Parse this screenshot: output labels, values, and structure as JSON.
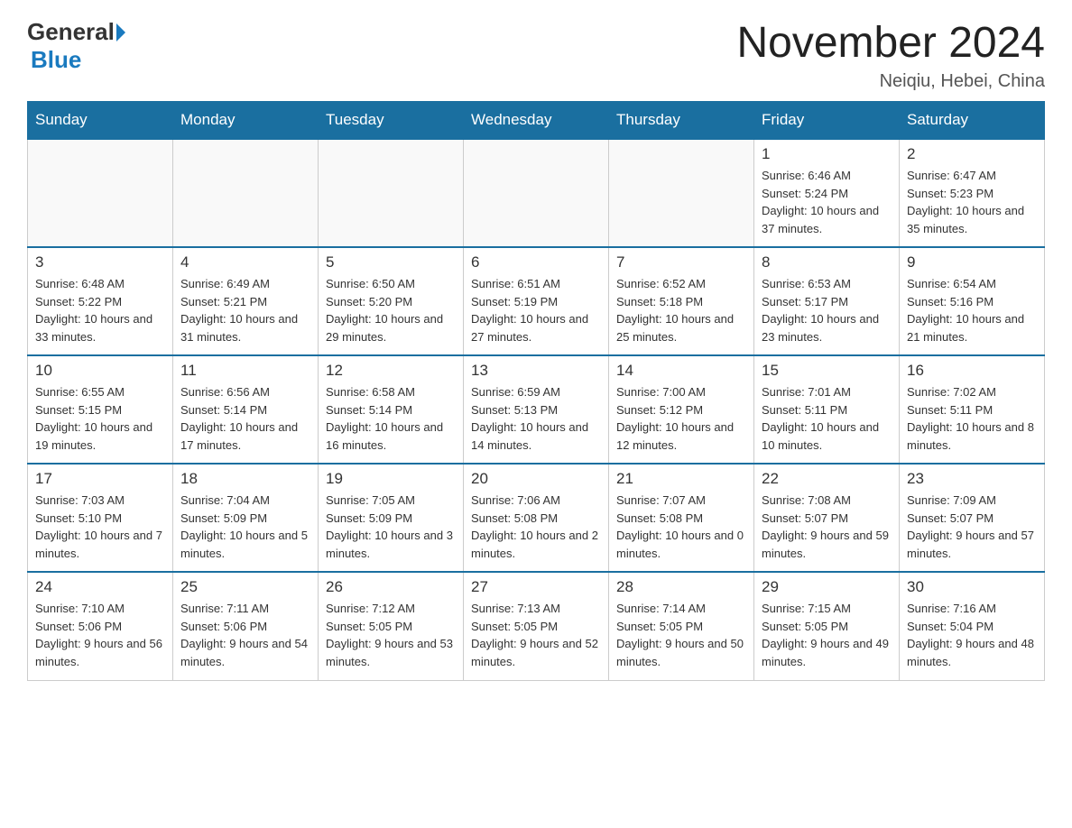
{
  "header": {
    "logo_general": "General",
    "logo_blue": "Blue",
    "title": "November 2024",
    "subtitle": "Neiqiu, Hebei, China"
  },
  "days_of_week": [
    "Sunday",
    "Monday",
    "Tuesday",
    "Wednesday",
    "Thursday",
    "Friday",
    "Saturday"
  ],
  "weeks": [
    [
      {
        "day": "",
        "info": ""
      },
      {
        "day": "",
        "info": ""
      },
      {
        "day": "",
        "info": ""
      },
      {
        "day": "",
        "info": ""
      },
      {
        "day": "",
        "info": ""
      },
      {
        "day": "1",
        "info": "Sunrise: 6:46 AM\nSunset: 5:24 PM\nDaylight: 10 hours and 37 minutes."
      },
      {
        "day": "2",
        "info": "Sunrise: 6:47 AM\nSunset: 5:23 PM\nDaylight: 10 hours and 35 minutes."
      }
    ],
    [
      {
        "day": "3",
        "info": "Sunrise: 6:48 AM\nSunset: 5:22 PM\nDaylight: 10 hours and 33 minutes."
      },
      {
        "day": "4",
        "info": "Sunrise: 6:49 AM\nSunset: 5:21 PM\nDaylight: 10 hours and 31 minutes."
      },
      {
        "day": "5",
        "info": "Sunrise: 6:50 AM\nSunset: 5:20 PM\nDaylight: 10 hours and 29 minutes."
      },
      {
        "day": "6",
        "info": "Sunrise: 6:51 AM\nSunset: 5:19 PM\nDaylight: 10 hours and 27 minutes."
      },
      {
        "day": "7",
        "info": "Sunrise: 6:52 AM\nSunset: 5:18 PM\nDaylight: 10 hours and 25 minutes."
      },
      {
        "day": "8",
        "info": "Sunrise: 6:53 AM\nSunset: 5:17 PM\nDaylight: 10 hours and 23 minutes."
      },
      {
        "day": "9",
        "info": "Sunrise: 6:54 AM\nSunset: 5:16 PM\nDaylight: 10 hours and 21 minutes."
      }
    ],
    [
      {
        "day": "10",
        "info": "Sunrise: 6:55 AM\nSunset: 5:15 PM\nDaylight: 10 hours and 19 minutes."
      },
      {
        "day": "11",
        "info": "Sunrise: 6:56 AM\nSunset: 5:14 PM\nDaylight: 10 hours and 17 minutes."
      },
      {
        "day": "12",
        "info": "Sunrise: 6:58 AM\nSunset: 5:14 PM\nDaylight: 10 hours and 16 minutes."
      },
      {
        "day": "13",
        "info": "Sunrise: 6:59 AM\nSunset: 5:13 PM\nDaylight: 10 hours and 14 minutes."
      },
      {
        "day": "14",
        "info": "Sunrise: 7:00 AM\nSunset: 5:12 PM\nDaylight: 10 hours and 12 minutes."
      },
      {
        "day": "15",
        "info": "Sunrise: 7:01 AM\nSunset: 5:11 PM\nDaylight: 10 hours and 10 minutes."
      },
      {
        "day": "16",
        "info": "Sunrise: 7:02 AM\nSunset: 5:11 PM\nDaylight: 10 hours and 8 minutes."
      }
    ],
    [
      {
        "day": "17",
        "info": "Sunrise: 7:03 AM\nSunset: 5:10 PM\nDaylight: 10 hours and 7 minutes."
      },
      {
        "day": "18",
        "info": "Sunrise: 7:04 AM\nSunset: 5:09 PM\nDaylight: 10 hours and 5 minutes."
      },
      {
        "day": "19",
        "info": "Sunrise: 7:05 AM\nSunset: 5:09 PM\nDaylight: 10 hours and 3 minutes."
      },
      {
        "day": "20",
        "info": "Sunrise: 7:06 AM\nSunset: 5:08 PM\nDaylight: 10 hours and 2 minutes."
      },
      {
        "day": "21",
        "info": "Sunrise: 7:07 AM\nSunset: 5:08 PM\nDaylight: 10 hours and 0 minutes."
      },
      {
        "day": "22",
        "info": "Sunrise: 7:08 AM\nSunset: 5:07 PM\nDaylight: 9 hours and 59 minutes."
      },
      {
        "day": "23",
        "info": "Sunrise: 7:09 AM\nSunset: 5:07 PM\nDaylight: 9 hours and 57 minutes."
      }
    ],
    [
      {
        "day": "24",
        "info": "Sunrise: 7:10 AM\nSunset: 5:06 PM\nDaylight: 9 hours and 56 minutes."
      },
      {
        "day": "25",
        "info": "Sunrise: 7:11 AM\nSunset: 5:06 PM\nDaylight: 9 hours and 54 minutes."
      },
      {
        "day": "26",
        "info": "Sunrise: 7:12 AM\nSunset: 5:05 PM\nDaylight: 9 hours and 53 minutes."
      },
      {
        "day": "27",
        "info": "Sunrise: 7:13 AM\nSunset: 5:05 PM\nDaylight: 9 hours and 52 minutes."
      },
      {
        "day": "28",
        "info": "Sunrise: 7:14 AM\nSunset: 5:05 PM\nDaylight: 9 hours and 50 minutes."
      },
      {
        "day": "29",
        "info": "Sunrise: 7:15 AM\nSunset: 5:05 PM\nDaylight: 9 hours and 49 minutes."
      },
      {
        "day": "30",
        "info": "Sunrise: 7:16 AM\nSunset: 5:04 PM\nDaylight: 9 hours and 48 minutes."
      }
    ]
  ]
}
